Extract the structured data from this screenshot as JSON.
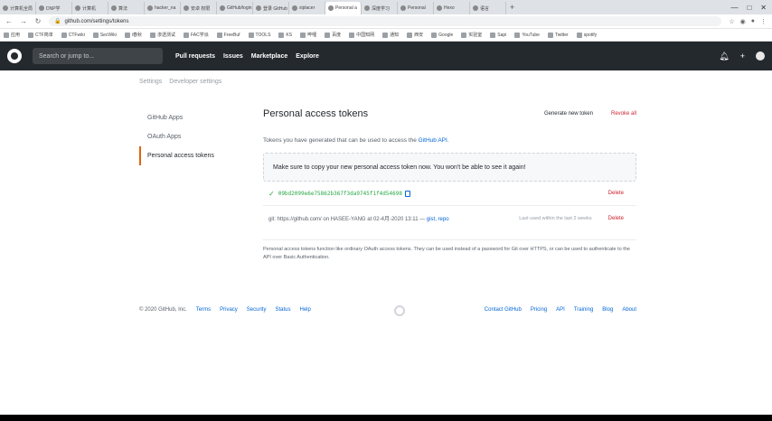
{
  "browser": {
    "tabs": [
      "计算机全局",
      "DNP学",
      "计算机",
      "算法",
      "hacker_na",
      "安卓 权限",
      "GitHub/login",
      "登录 GitHub",
      "xiplacer",
      "Personal a",
      "深度学习",
      "Personal",
      "Hexo",
      "语言"
    ],
    "active_tab_index": 9,
    "new_tab": "+",
    "window_controls": [
      "—",
      "□",
      "✕"
    ],
    "nav": {
      "back": "←",
      "forward": "→",
      "reload": "↻"
    },
    "url": "github.com/settings/tokens",
    "bookmarks": [
      "应用",
      "CTF简单",
      "CTFwiki",
      "SecWiki",
      "i春秋",
      "渗透测试",
      "FAC学派",
      "FreeBuf",
      "TOOLS",
      "KS",
      "哔哩",
      "百度",
      "中国知网",
      "通知",
      "西安",
      "Google",
      "实验室",
      "Sapi",
      "YouTube",
      "Twitter",
      "spotify"
    ]
  },
  "header": {
    "search_placeholder": "Search or jump to...",
    "nav": [
      "Pull requests",
      "Issues",
      "Marketplace",
      "Explore"
    ],
    "plus_icon": "+",
    "bell_icon": "🔔"
  },
  "breadcrumb": [
    "Settings",
    "Developer settings"
  ],
  "sidebar": {
    "items": [
      {
        "label": "GitHub Apps"
      },
      {
        "label": "OAuth Apps"
      },
      {
        "label": "Personal access tokens"
      }
    ]
  },
  "main": {
    "title": "Personal access tokens",
    "generate_label": "Generate new token",
    "revoke_all_label": "Revoke all",
    "desc_text": "Tokens you have generated that can be used to access the ",
    "desc_link": "GitHub API",
    "desc_end": ".",
    "notice": "Make sure to copy your new personal access token now. You won't be able to see it again!",
    "token_value": "09bd2099e6e75862b367f3da9745f1f4d54698",
    "delete_label": "Delete",
    "token_note_prefix": "git: https://github.com/ on HASEE-YANG at 02-4月-2020 13:11 — ",
    "token_scope": "gist, repo",
    "token_used": "Last used within the last 2 weeks",
    "delete_label_2": "Delete",
    "footnote": "Personal access tokens function like ordinary OAuth access tokens. They can be used instead of a password for Git over HTTPS, or can be used to authenticate to the API over Basic Authentication."
  },
  "footer": {
    "copyright": "© 2020 GitHub, Inc.",
    "left_links": [
      "Terms",
      "Privacy",
      "Security",
      "Status",
      "Help"
    ],
    "right_links": [
      "Contact GitHub",
      "Pricing",
      "API",
      "Training",
      "Blog",
      "About"
    ]
  }
}
